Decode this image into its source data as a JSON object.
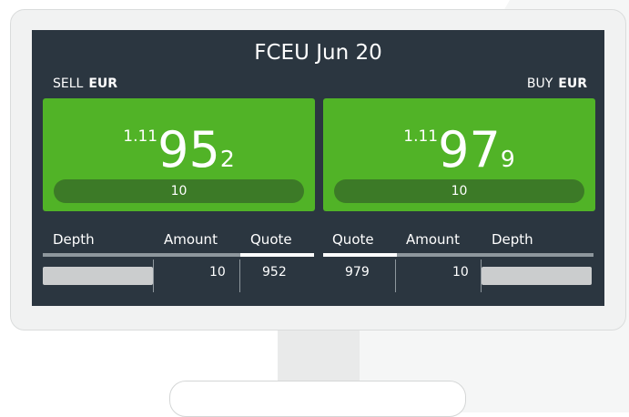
{
  "instrument": {
    "title": "FCEU Jun 20"
  },
  "sell": {
    "side": "SELL",
    "currency": "EUR",
    "price_prefix": "1.11",
    "price_big": "95",
    "price_pip": "2",
    "amount": "10"
  },
  "buy": {
    "side": "BUY",
    "currency": "EUR",
    "price_prefix": "1.11",
    "price_big": "97",
    "price_pip": "9",
    "amount": "10"
  },
  "depth_table": {
    "headers": {
      "sell_depth": "Depth",
      "sell_amount": "Amount",
      "sell_quote": "Quote",
      "buy_quote": "Quote",
      "buy_amount": "Amount",
      "buy_depth": "Depth"
    },
    "row": {
      "sell_amount": "10",
      "sell_quote": "952",
      "buy_quote": "979",
      "buy_amount": "10"
    }
  },
  "colors": {
    "screen_bg": "#2b3640",
    "price_green": "#51b327",
    "pill_dark_green": "#3c7a27",
    "depth_bar": "#cbcdce"
  }
}
